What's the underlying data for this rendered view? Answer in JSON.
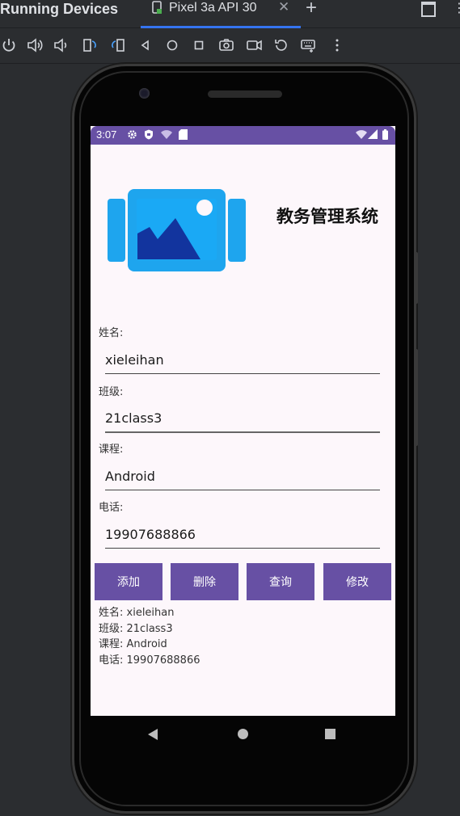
{
  "ide": {
    "panel_title": "Running Devices",
    "tab_label": "Pixel 3a API 30",
    "tab_close": "✕",
    "add_tab": "+",
    "more": "⋮",
    "accent": "#3574f0"
  },
  "toolbar": {
    "icons": [
      "power-icon",
      "volume-up-icon",
      "volume-down-icon",
      "rotate-left-icon",
      "rotate-right-icon",
      "back-icon",
      "home-icon",
      "overview-icon",
      "screenshot-icon",
      "screen-record-icon",
      "reset-icon",
      "keyboard-icon",
      "more-icon"
    ]
  },
  "status_bar": {
    "time": "3:07",
    "color": "#6750a4"
  },
  "app": {
    "title": "教务管理系统",
    "fields": [
      {
        "label": "姓名:",
        "value": "xieleihan"
      },
      {
        "label": "班级:",
        "value": "21class3"
      },
      {
        "label": "课程:",
        "value": "Android"
      },
      {
        "label": "电话:",
        "value": "19907688866"
      }
    ],
    "buttons": [
      "添加",
      "删除",
      "查询",
      "修改"
    ],
    "results": [
      "姓名: xieleihan",
      "班级: 21class3",
      "课程: Android",
      "电话: 19907688866"
    ],
    "button_color": "#6750a4"
  }
}
